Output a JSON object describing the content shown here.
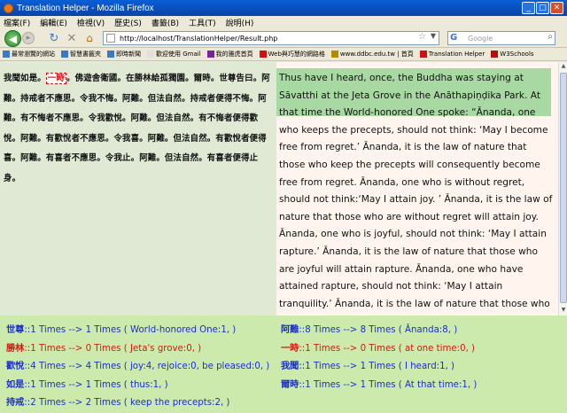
{
  "window": {
    "title": "Translation Helper - Mozilla Firefox",
    "min": "_",
    "max": "□",
    "close": "✕"
  },
  "menu": [
    "檔案(F)",
    "編輯(E)",
    "檢視(V)",
    "歷史(S)",
    "書籤(B)",
    "工具(T)",
    "說明(H)"
  ],
  "nav": {
    "back": "◀",
    "forward": "▸",
    "reload": "↻",
    "stop": "✕",
    "home": "⌂",
    "url": "http://localhost/TranslationHelper/Result.php",
    "search_placeholder": "Google"
  },
  "bookmarks": [
    {
      "label": "最常瀏覽的網站",
      "color": "#3a78c9"
    },
    {
      "label": "智慧書籤夾",
      "color": "#3a78c9"
    },
    {
      "label": "即時新聞",
      "color": "#3a78c9"
    },
    {
      "label": "歡迎使用 Gmail",
      "color": "#e0e0e0"
    },
    {
      "label": "我的雅虎首頁",
      "color": "#7b1fa2"
    },
    {
      "label": "Web與巧慧的網路格",
      "color": "#d01010"
    },
    {
      "label": "www.ddbc.edu.tw | 首頁",
      "color": "#b38a00"
    },
    {
      "label": "Translation Helper",
      "color": "#d01010"
    },
    {
      "label": "W3Schools",
      "color": "#b01010"
    }
  ],
  "left_pane": {
    "before": "我聞如是。",
    "highlight": "一時",
    "after": "。佛遊舍衛國。在勝林給孤獨園。爾時。世尊告曰。阿難。持戒者不應思。令我不悔。阿難。但法自然。持戒者便得不悔。阿難。有不悔者不應思。令我歡悅。阿難。但法自然。有不悔者便得歡悅。阿難。有歡悅者不應思。令我喜。阿難。但法自然。有歡悅者便得喜。阿難。有喜者不應思。令我止。阿難。但法自然。有喜者便得止身。"
  },
  "right_pane": {
    "highlighted": "Thus have I heard, once, the Buddha was staying at Sāvatthi at the Jeta Grove in the Anāthapiṇḍika Park.",
    "rest": " At that time the World-honored One spoke: “Ānanda, one who keeps the precepts, should not think: ‘May I become free from regret.’ Ānanda, it is the law of nature that those who keep the precepts will consequently become free from regret. Ānanda, one who is without regret, should not think:‘May I attain joy. ’ Ānanda, it is the law of nature that those who are without regret will attain joy. Ānanda, one who is joyful, should not think: ‘May I attain rapture.’ Ānanda, it is the law of nature that those who are joyful will attain rapture. Ānanda, one who have attained rapture, should not think: ‘May I attain tranquility.’ Ānanda, it is the law of nature that those who are have attained rapture will attain tranquility of the body."
  },
  "stats": {
    "colors": {
      "blue": "#1a2fd0",
      "red": "#d21b10"
    },
    "left": [
      {
        "term": "世尊",
        "rest": "::1 Times --> 1 Times ( World-honored One:1, )",
        "color": "blue"
      },
      {
        "term": "勝林",
        "rest": "::1 Times --> 0 Times ( Jeta's grove:0, )",
        "color": "red"
      },
      {
        "term": "歡悅",
        "rest": "::4 Times --> 4 Times ( joy:4, rejoice:0, be pleased:0, )",
        "color": "blue"
      },
      {
        "term": "如是",
        "rest": "::1 Times --> 1 Times ( thus:1, )",
        "color": "blue"
      },
      {
        "term": "持戒",
        "rest": "::2 Times --> 2 Times ( keep the precepts:2, )",
        "color": "blue"
      }
    ],
    "right": [
      {
        "term": "阿難",
        "rest": "::8 Times --> 8 Times ( Ānanda:8, )",
        "color": "blue"
      },
      {
        "term": "一時",
        "rest": "::1 Times --> 0 Times ( at one time:0, )",
        "color": "red"
      },
      {
        "term": "我聞",
        "rest": "::1 Times --> 1 Times ( I heard:1, )",
        "color": "blue"
      },
      {
        "term": "爾時",
        "rest": "::1 Times --> 1 Times ( At that time:1, )",
        "color": "blue"
      }
    ]
  }
}
